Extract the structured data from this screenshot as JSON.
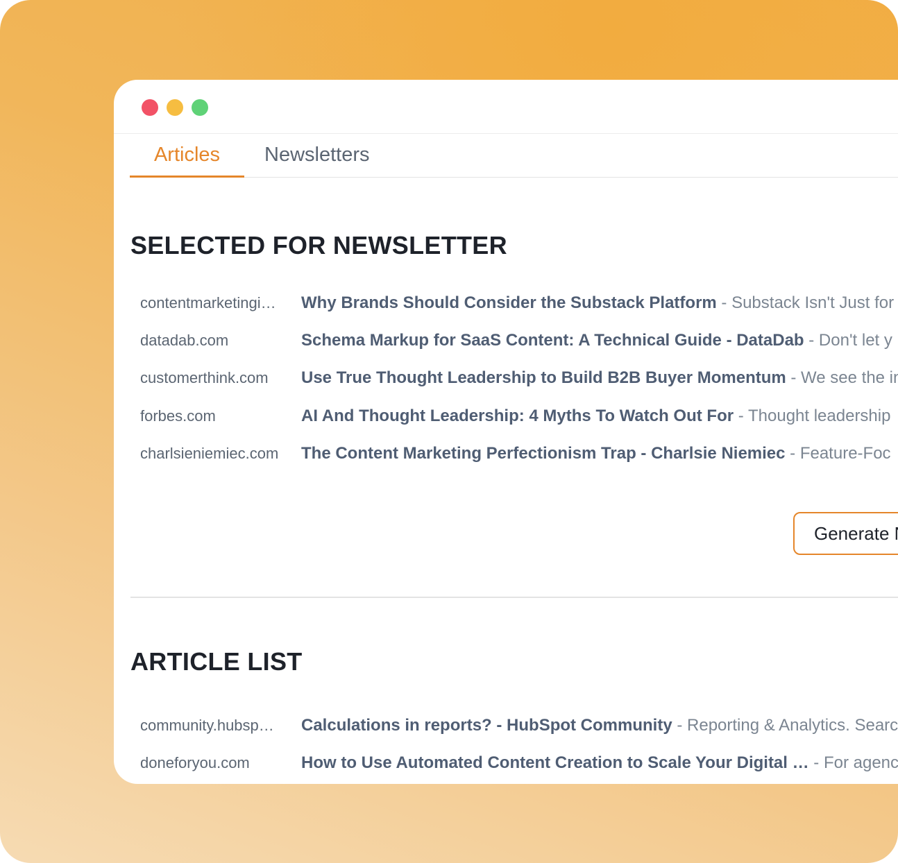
{
  "tabs": {
    "articles": "Articles",
    "newsletters": "Newsletters"
  },
  "selected": {
    "title": "SELECTED FOR NEWSLETTER",
    "rows": [
      {
        "domain": "contentmarketingi…",
        "title": "Why Brands Should Consider the Substack Platform",
        "sep": " - ",
        "desc": "Substack Isn't Just for"
      },
      {
        "domain": "datadab.com",
        "title": "Schema Markup for SaaS Content: A Technical Guide - DataDab",
        "sep": " - ",
        "desc": "Don't let y"
      },
      {
        "domain": "customerthink.com",
        "title": "Use True Thought Leadership to Build B2B Buyer Momentum",
        "sep": " - ",
        "desc": "We see the in"
      },
      {
        "domain": "forbes.com",
        "title": "AI And Thought Leadership: 4 Myths To Watch Out For",
        "sep": " - ",
        "desc": "Thought leadership"
      },
      {
        "domain": "charlsieniemiec.com",
        "title": "The Content Marketing Perfectionism Trap - Charlsie Niemiec",
        "sep": " - ",
        "desc": "Feature-Foc"
      }
    ],
    "generate_label": "Generate N"
  },
  "article_list": {
    "title": "ARTICLE LIST",
    "rows": [
      {
        "domain": "community.hubsp…",
        "title": "Calculations in reports? - HubSpot Community",
        "sep": " - ",
        "desc": "Reporting & Analytics. Searc"
      },
      {
        "domain": "doneforyou.com",
        "title": "How to Use Automated Content Creation to Scale Your Digital …",
        "sep": " - ",
        "desc": "For agenc"
      }
    ]
  },
  "colors": {
    "accent": "#e5862a",
    "title_text": "#4f5d73",
    "muted_text": "#7b8591"
  }
}
